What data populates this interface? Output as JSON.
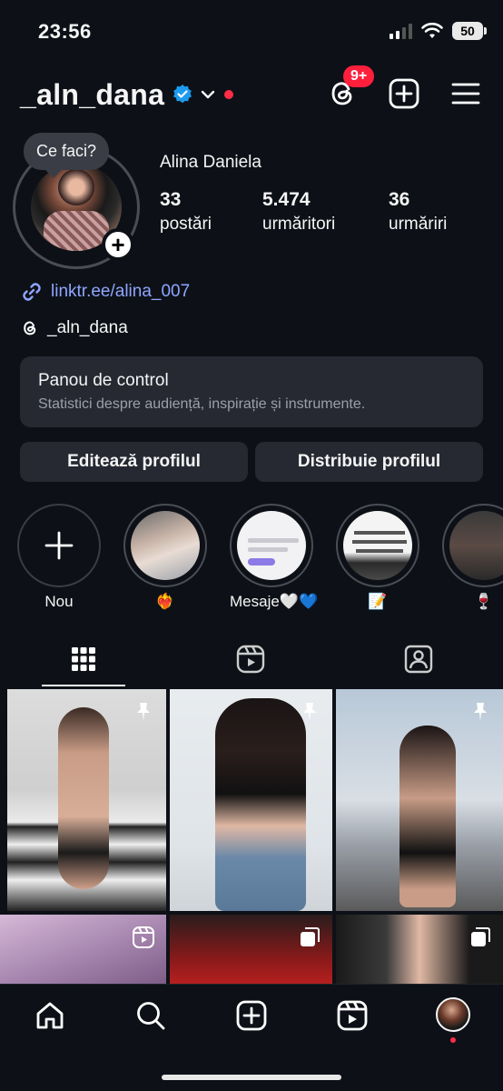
{
  "status_bar": {
    "time": "23:56",
    "battery": "50"
  },
  "header": {
    "username": "_aln_dana",
    "threads_badge": "9+"
  },
  "profile": {
    "note": "Ce faci?",
    "full_name": "Alina Daniela",
    "stats": [
      {
        "value": "33",
        "label": "postări"
      },
      {
        "value": "5.474",
        "label": "urmăritori"
      },
      {
        "value": "36",
        "label": "urmăriri"
      }
    ],
    "link": "linktr.ee/alina_007",
    "threads_handle": "_aln_dana"
  },
  "dashboard": {
    "title": "Panou de control",
    "subtitle": "Statistici despre audiență, inspirație și instrumente."
  },
  "buttons": {
    "edit": "Editează profilul",
    "share": "Distribuie profilul"
  },
  "highlights": [
    {
      "label": "Nou"
    },
    {
      "label": "❤️‍🔥"
    },
    {
      "label": "Mesaje🤍💙"
    },
    {
      "label": "📝"
    },
    {
      "label": "🍷"
    }
  ],
  "colors": {
    "background": "#0d1117",
    "surface": "#262932",
    "link": "#8fa6ff",
    "badge": "#ff1f3d",
    "verified": "#1d9bf0"
  }
}
